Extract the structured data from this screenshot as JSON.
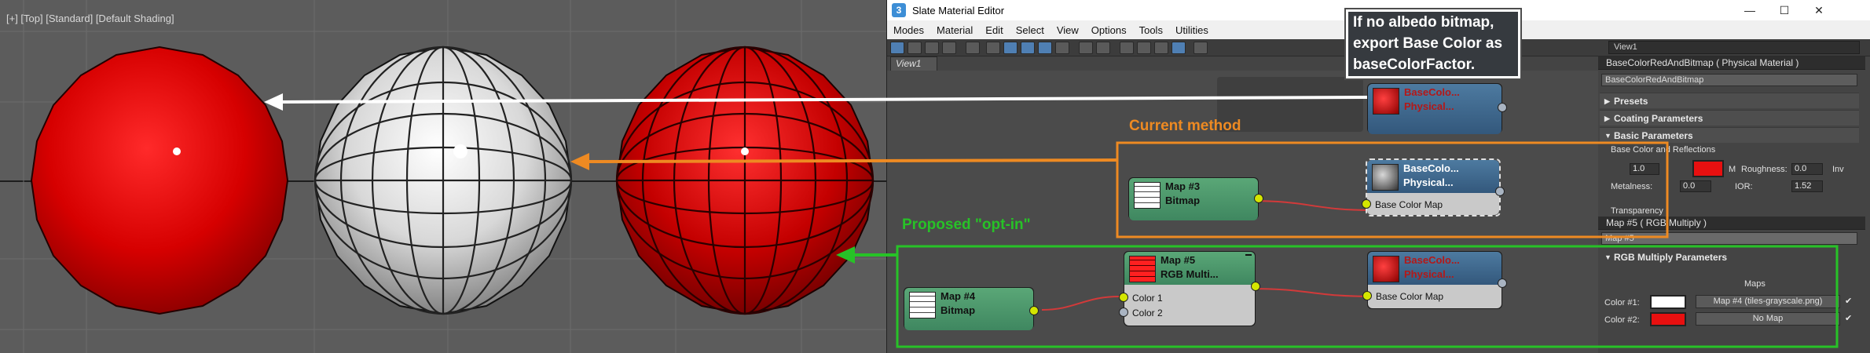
{
  "viewport": {
    "label": "[+] [Top] [Standard] [Default Shading]"
  },
  "window": {
    "title": "Slate Material Editor",
    "icon_glyph": "3",
    "controls": [
      "—",
      "☐",
      "✕"
    ]
  },
  "menu": [
    "Modes",
    "Material",
    "Edit",
    "Select",
    "View",
    "Options",
    "Tools",
    "Utilities"
  ],
  "toolbar": {
    "view_select": "View1"
  },
  "view_tab": "View1",
  "callout": {
    "lines": [
      "If no albedo bitmap,",
      "export Base Color as",
      "baseColorFactor."
    ]
  },
  "annotations": {
    "current": "Current method",
    "proposed": "Proposed \"opt-in\""
  },
  "nodes": {
    "top_material": {
      "title": "BaseColo...",
      "subtitle": "Physical..."
    },
    "mid_map": {
      "title": "Map #3",
      "subtitle": "Bitmap"
    },
    "mid_material": {
      "title": "BaseColo...",
      "subtitle": "Physical...",
      "slot": "Base Color Map"
    },
    "bot_map4": {
      "title": "Map #4",
      "subtitle": "Bitmap"
    },
    "bot_map5": {
      "title": "Map #5",
      "subtitle": "RGB Multi...",
      "slots": [
        "Color 1",
        "Color 2"
      ]
    },
    "bot_material": {
      "title": "BaseColo...",
      "subtitle": "Physical...",
      "slot": "Base Color Map"
    }
  },
  "panel": {
    "material_title": "BaseColorRedAndBitmap  ( Physical Material )",
    "material_name": "BaseColorRedAndBitmap",
    "rollouts": [
      "Presets",
      "Coating Parameters",
      "Basic Parameters"
    ],
    "section_label": "Base Color and Reflections",
    "base_weight": "1.0",
    "m_label": "M",
    "roughness_label": "Roughness:",
    "roughness": "0.0",
    "inv_label": "Inv",
    "metalness_label": "Metalness:",
    "metalness": "0.0",
    "ior_label": "IOR:",
    "ior": "1.52",
    "transparency_label": "Transparency",
    "map_title": "Map #5  ( RGB Multiply )",
    "map_name": "Map #5",
    "map_rollout": "RGB Multiply Parameters",
    "maps_label": "Maps",
    "color1_label": "Color #1:",
    "color1_map": "Map #4 (tiles-grayscale.png)",
    "color2_label": "Color #2:",
    "color2_map": "No Map",
    "check": "✔"
  },
  "colors": {
    "accent_orange": "#ee8a22",
    "accent_green": "#27c227",
    "base_red": "#e81010",
    "node_blue": "#3f6a8f",
    "node_green": "#4c9a6b"
  }
}
